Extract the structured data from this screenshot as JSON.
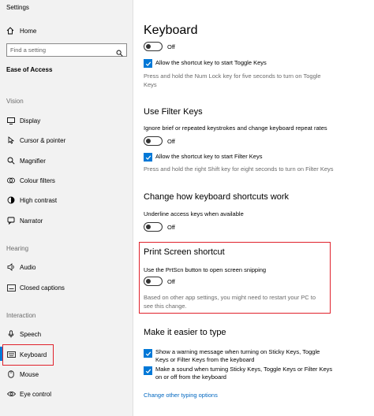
{
  "app_title": "Settings",
  "sidebar": {
    "home_label": "Home",
    "search_placeholder": "Find a setting",
    "section_title": "Ease of Access",
    "groups": {
      "vision": "Vision",
      "hearing": "Hearing",
      "interaction": "Interaction"
    },
    "items": [
      {
        "label": "Display",
        "icon": "display-icon"
      },
      {
        "label": "Cursor & pointer",
        "icon": "cursor-icon"
      },
      {
        "label": "Magnifier",
        "icon": "magnifier-icon"
      },
      {
        "label": "Colour filters",
        "icon": "colour-filters-icon"
      },
      {
        "label": "High contrast",
        "icon": "high-contrast-icon"
      },
      {
        "label": "Narrator",
        "icon": "narrator-icon"
      },
      {
        "label": "Audio",
        "icon": "audio-icon"
      },
      {
        "label": "Closed captions",
        "icon": "captions-icon"
      },
      {
        "label": "Speech",
        "icon": "speech-icon"
      },
      {
        "label": "Keyboard",
        "icon": "keyboard-icon",
        "selected": true
      },
      {
        "label": "Mouse",
        "icon": "mouse-icon"
      },
      {
        "label": "Eye control",
        "icon": "eye-icon"
      }
    ]
  },
  "main": {
    "page_title": "Keyboard",
    "toggle_keys": {
      "toggle_state": "Off",
      "checkbox_label": "Allow the shortcut key to start Toggle Keys",
      "description": "Press and hold the Num Lock key for five seconds to turn on Toggle Keys"
    },
    "filter_keys": {
      "heading": "Use Filter Keys",
      "description_top": "Ignore brief or repeated keystrokes and change keyboard repeat rates",
      "toggle_state": "Off",
      "checkbox_label": "Allow the shortcut key to start Filter Keys",
      "description": "Press and hold the right Shift key for eight seconds to turn on Filter Keys"
    },
    "shortcuts": {
      "heading": "Change how keyboard shortcuts work",
      "underline_label": "Underline access keys when available",
      "toggle_state": "Off"
    },
    "print_screen": {
      "heading": "Print Screen shortcut",
      "label": "Use the PrtScn button to open screen snipping",
      "toggle_state": "Off",
      "note": "Based on other app settings, you might need to restart your PC to see this change."
    },
    "typing": {
      "heading": "Make it easier to type",
      "check1": "Show a warning message when turning on Sticky Keys, Toggle Keys or Filter Keys from the keyboard",
      "check2": "Make a sound when turning Sticky Keys, Toggle Keys or Filter Keys on or off from the keyboard",
      "link": "Change other typing options"
    }
  },
  "colors": {
    "accent": "#0078d7",
    "highlight_box": "#e0212b",
    "link": "#0067c0"
  }
}
